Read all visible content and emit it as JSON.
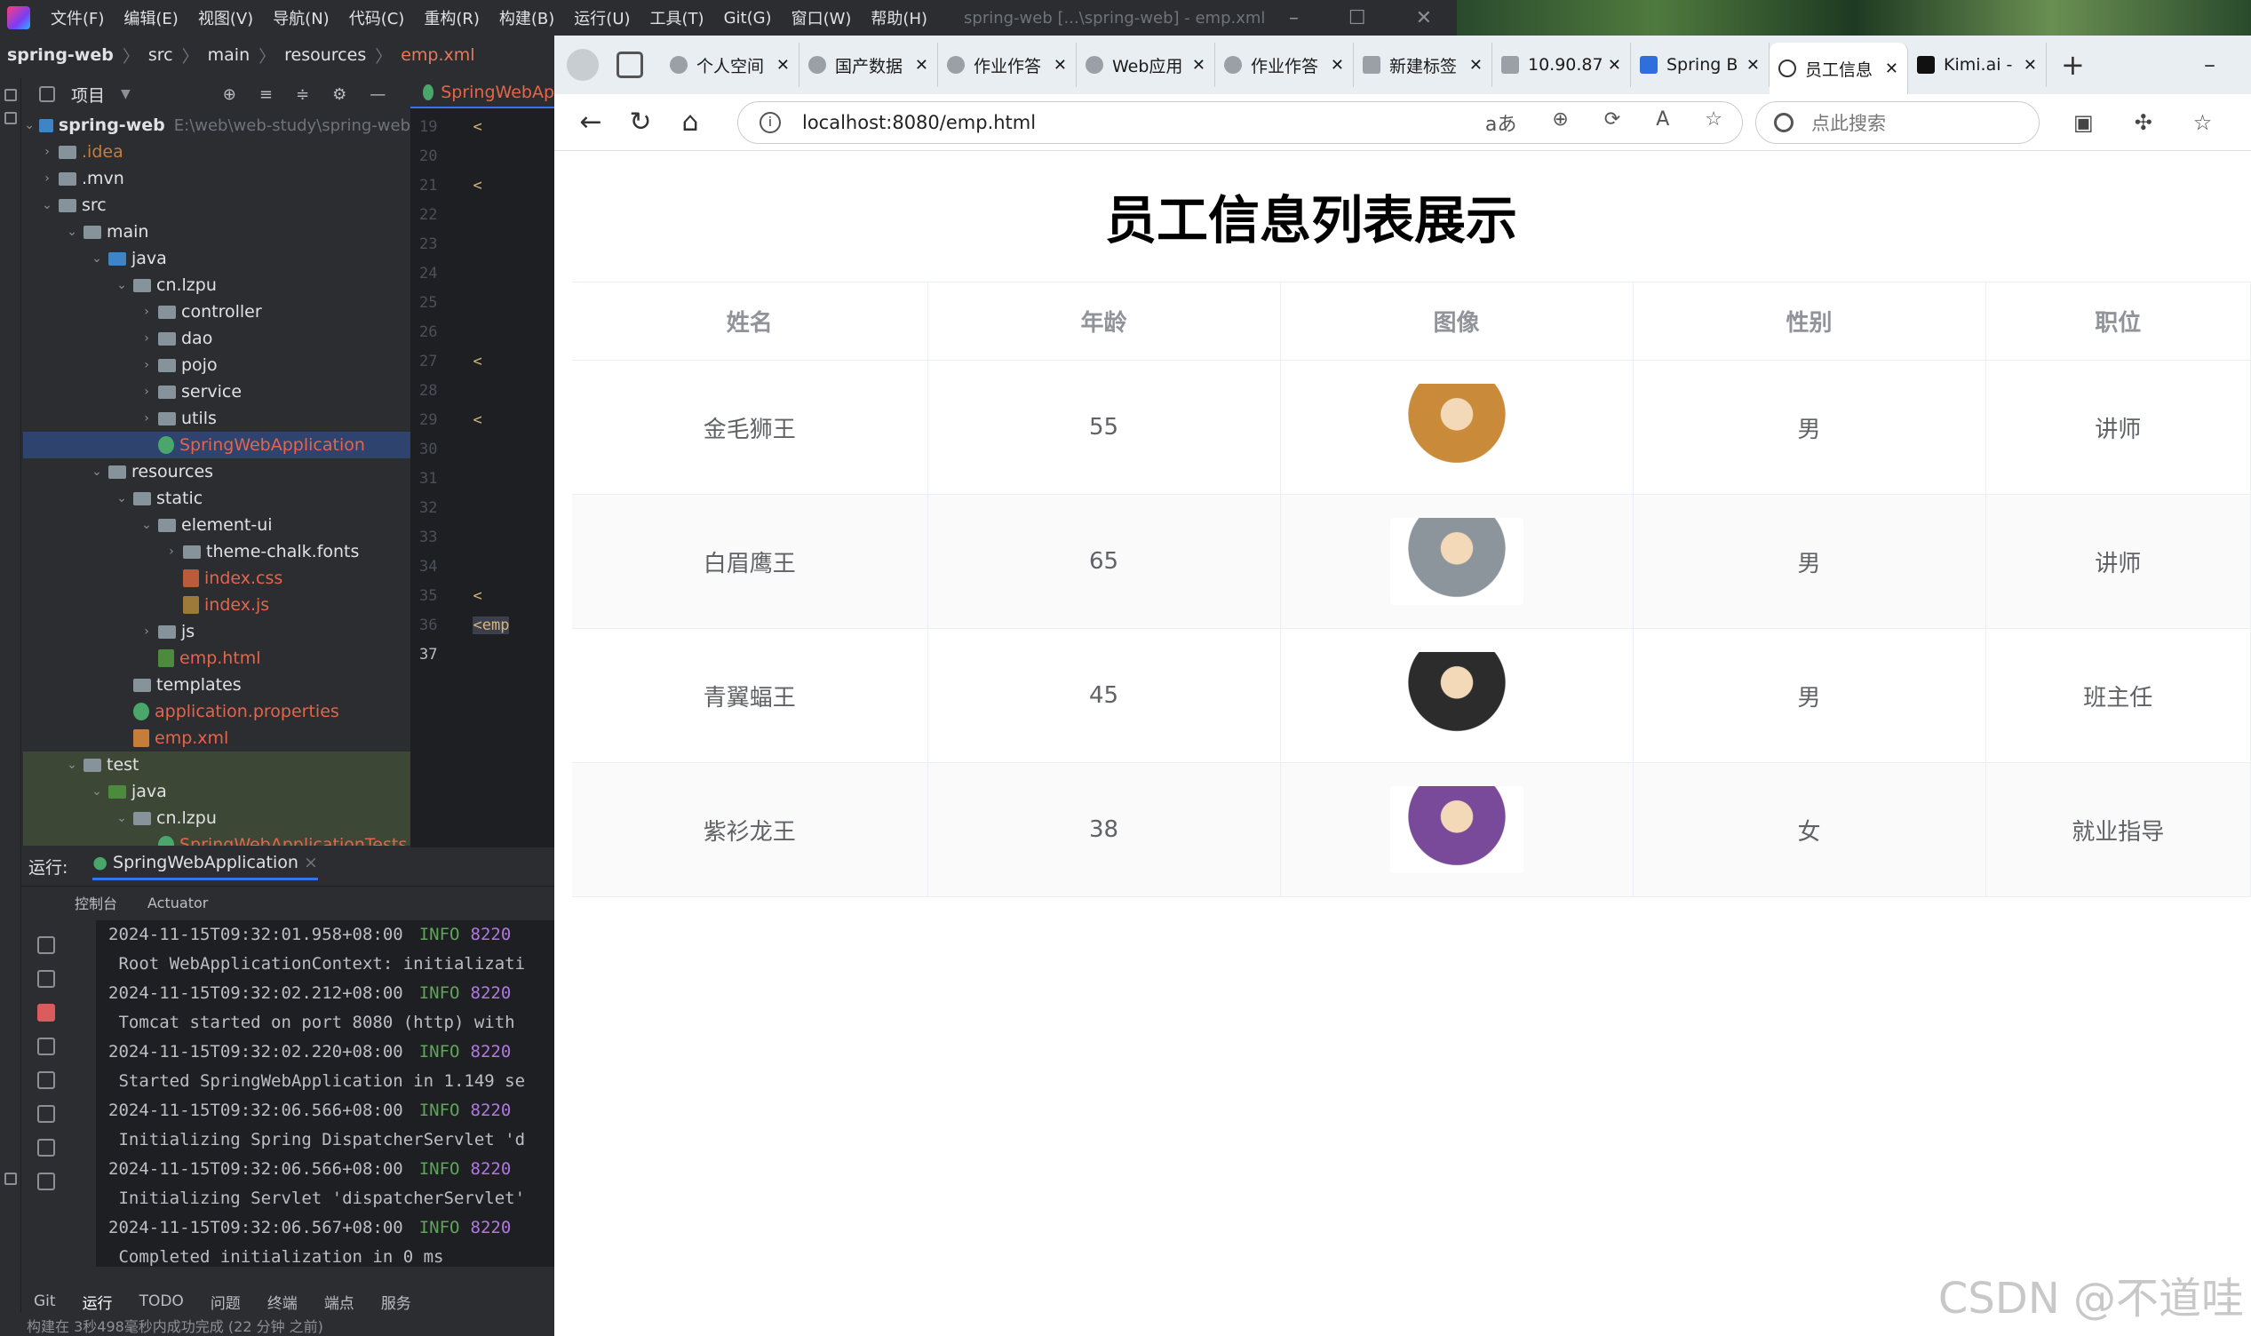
{
  "ide": {
    "menu": [
      "文件(F)",
      "编辑(E)",
      "视图(V)",
      "导航(N)",
      "代码(C)",
      "重构(R)",
      "构建(B)",
      "运行(U)",
      "工具(T)",
      "Git(G)",
      "窗口(W)",
      "帮助(H)"
    ],
    "title": "spring-web [...\\spring-web] - emp.xml",
    "breadcrumb": [
      "spring-web",
      "src",
      "main",
      "resources",
      "emp.xml"
    ],
    "project_label": "项目",
    "root_name": "spring-web",
    "root_path": "E:\\web\\web-study\\spring-web",
    "tree": [
      ".idea",
      ".mvn",
      "src",
      "main",
      "java",
      "cn.lzpu",
      "controller",
      "dao",
      "pojo",
      "service",
      "utils",
      "SpringWebApplication",
      "resources",
      "static",
      "element-ui",
      "theme-chalk.fonts",
      "index.css",
      "index.js",
      "js",
      "emp.html",
      "templates",
      "application.properties",
      "emp.xml",
      "test",
      "java",
      "cn.lzpu",
      "SpringWebApplicationTests"
    ],
    "editor_tab": "SpringWebAp",
    "line_numbers": [
      "19",
      "20",
      "21",
      "22",
      "23",
      "24",
      "25",
      "26",
      "27",
      "28",
      "29",
      "30",
      "31",
      "32",
      "33",
      "34",
      "35",
      "36",
      "37"
    ],
    "line36_text": "<emp",
    "run_label": "运行:",
    "run_config": "SpringWebApplication",
    "run_subtabs": [
      "控制台",
      "Actuator"
    ],
    "console": [
      {
        "ts": "2024-11-15T09:32:01.958+08:00",
        "level": "INFO",
        "pid": "8220"
      },
      {
        "msg": "Root WebApplicationContext: initializati"
      },
      {
        "ts": "2024-11-15T09:32:02.212+08:00",
        "level": "INFO",
        "pid": "8220"
      },
      {
        "msg": "Tomcat started on port 8080 (http) with"
      },
      {
        "ts": "2024-11-15T09:32:02.220+08:00",
        "level": "INFO",
        "pid": "8220"
      },
      {
        "msg": "Started SpringWebApplication in 1.149 se"
      },
      {
        "ts": "2024-11-15T09:32:06.566+08:00",
        "level": "INFO",
        "pid": "8220"
      },
      {
        "msg": "Initializing Spring DispatcherServlet 'd"
      },
      {
        "ts": "2024-11-15T09:32:06.566+08:00",
        "level": "INFO",
        "pid": "8220"
      },
      {
        "msg": "Initializing Servlet 'dispatcherServlet'"
      },
      {
        "ts": "2024-11-15T09:32:06.567+08:00",
        "level": "INFO",
        "pid": "8220"
      },
      {
        "msg": "Completed initialization in 0 ms"
      }
    ],
    "bottom_tabs": [
      "Git",
      "运行",
      "TODO",
      "问题",
      "终端",
      "端点",
      "服务"
    ],
    "status": "构建在 3秒498毫秒内成功完成 (22 分钟 之前)"
  },
  "browser": {
    "tabs": [
      {
        "label": "个人空间"
      },
      {
        "label": "国产数据"
      },
      {
        "label": "作业作答"
      },
      {
        "label": "Web应用"
      },
      {
        "label": "作业作答"
      },
      {
        "label": "新建标签"
      },
      {
        "label": "10.90.87"
      },
      {
        "label": "Spring B"
      },
      {
        "label": "员工信息"
      },
      {
        "label": "Kimi.ai -"
      }
    ],
    "url": "localhost:8080/emp.html",
    "search_placeholder": "点此搜索",
    "page_title": "员工信息列表展示",
    "columns": [
      "姓名",
      "年龄",
      "图像",
      "性别",
      "职位"
    ],
    "rows": [
      {
        "name": "金毛狮王",
        "age": "55",
        "gender": "男",
        "job": "讲师",
        "img_color": "#c98a3a"
      },
      {
        "name": "白眉鹰王",
        "age": "65",
        "gender": "男",
        "job": "讲师",
        "img_color": "#8d959c"
      },
      {
        "name": "青翼蝠王",
        "age": "45",
        "gender": "男",
        "job": "班主任",
        "img_color": "#2c2c2c"
      },
      {
        "name": "紫衫龙王",
        "age": "38",
        "gender": "女",
        "job": "就业指导",
        "img_color": "#7a4a9a"
      }
    ],
    "watermark": "CSDN @不道哇"
  }
}
